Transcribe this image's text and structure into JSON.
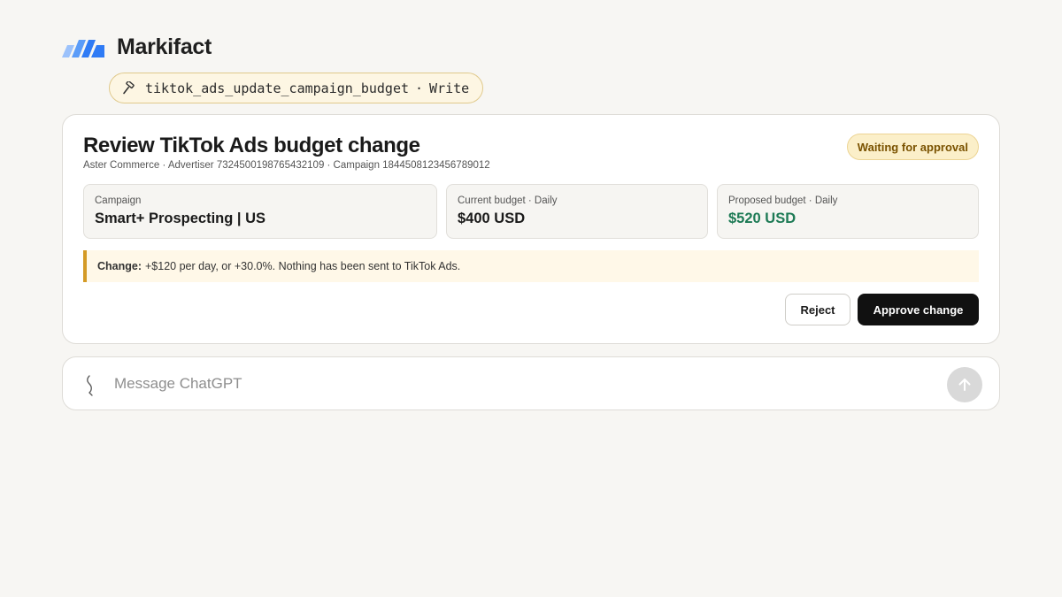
{
  "app": {
    "brand": "Markifact"
  },
  "tool": {
    "name": "tiktok_ads_update_campaign_budget",
    "separator": "·",
    "mode": "Write",
    "icon": "hammer-icon"
  },
  "card": {
    "title": "Review TikTok Ads budget change",
    "subtitle": "Aster Commerce · Advertiser 7324500198765432109 · Campaign 1844508123456789012",
    "status": "Waiting for approval",
    "fields": [
      {
        "label": "Campaign",
        "value": "Smart+ Prospecting | US"
      },
      {
        "label": "Current budget · Daily",
        "value": "$400 USD"
      },
      {
        "label": "Proposed budget · Daily",
        "value": "$520 USD"
      }
    ],
    "change_label": "Change:",
    "change_text": "+$120 per day, or +30.0%. Nothing has been sent to TikTok Ads.",
    "reject_label": "Reject",
    "approve_label": "Approve change"
  },
  "composer": {
    "placeholder": "Message ChatGPT",
    "value": ""
  },
  "colors": {
    "accent_blue": "#2f7bf5",
    "status_bg": "#fbefc9",
    "status_text": "#7a5200",
    "proposed_value": "#1d7a55",
    "change_border": "#d49a25",
    "approve_bg": "#111111"
  }
}
